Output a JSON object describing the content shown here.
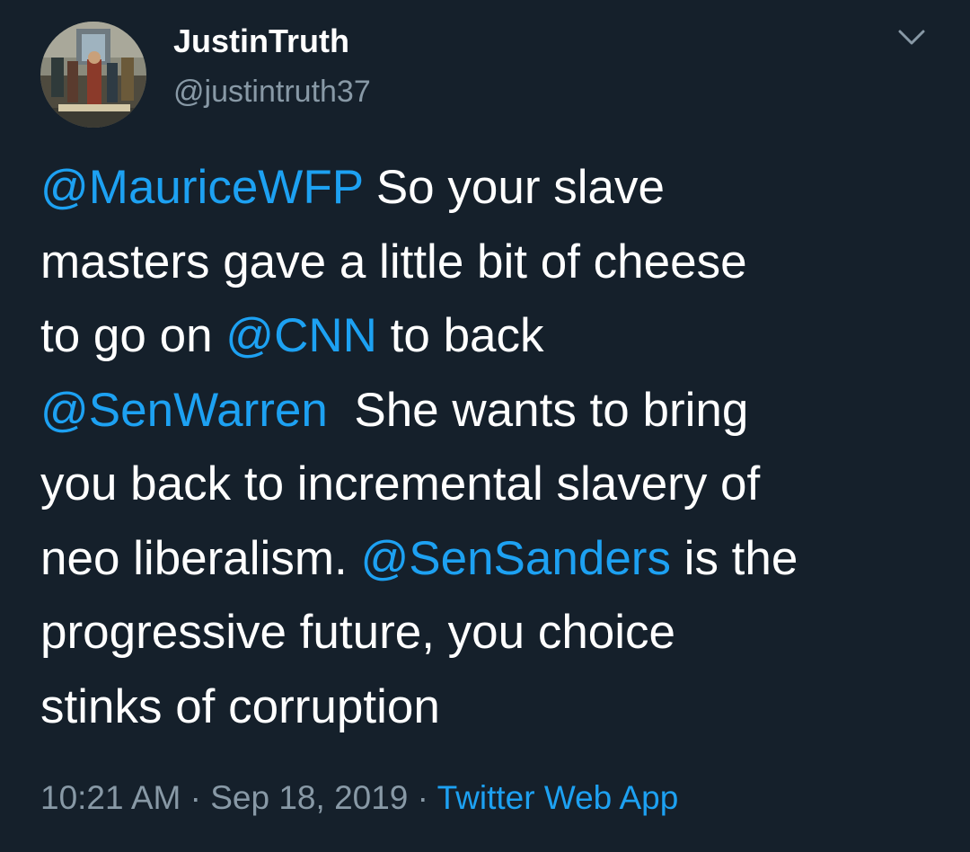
{
  "colors": {
    "background": "#15202b",
    "text": "#ffffff",
    "secondary_text": "#8899a6",
    "link": "#1da1f2"
  },
  "author": {
    "display_name": "JustinTruth",
    "handle": "@justintruth37",
    "avatar_icon": "avatar-painting"
  },
  "menu": {
    "icon": "chevron-down-icon"
  },
  "tweet": {
    "lines": [
      [
        {
          "text": "@MauriceWFP",
          "type": "mention"
        },
        {
          "text": " So your slave",
          "type": "text"
        }
      ],
      [
        {
          "text": "masters gave a little bit of cheese",
          "type": "text"
        }
      ],
      [
        {
          "text": "to go on ",
          "type": "text"
        },
        {
          "text": "@CNN",
          "type": "mention"
        },
        {
          "text": " to back",
          "type": "text"
        }
      ],
      [
        {
          "text": "@SenWarren",
          "type": "mention"
        },
        {
          "text": "  She wants to bring",
          "type": "text"
        }
      ],
      [
        {
          "text": "you back to incremental slavery of",
          "type": "text"
        }
      ],
      [
        {
          "text": "neo liberalism. ",
          "type": "text"
        },
        {
          "text": "@SenSanders",
          "type": "mention"
        },
        {
          "text": " is the",
          "type": "text"
        }
      ],
      [
        {
          "text": "progressive future, you choice",
          "type": "text"
        }
      ],
      [
        {
          "text": "stinks of corruption",
          "type": "text"
        }
      ]
    ]
  },
  "meta": {
    "time": "10:21 AM",
    "separator": " · ",
    "date": "Sep 18, 2019",
    "source": "Twitter Web App"
  }
}
